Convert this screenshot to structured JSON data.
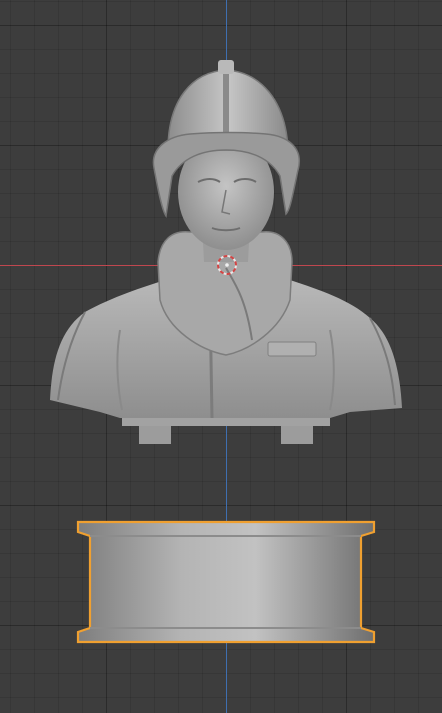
{
  "viewport": {
    "background": "#3d3d3d",
    "grid_color": "#2f2f2f",
    "x_axis_color": "#c0474f",
    "y_axis_color": "#3f6fb0",
    "selection_outline_color": "#f0a030",
    "model_color": "#a9a9a9"
  },
  "objects": {
    "bust": {
      "icon": "bust-model",
      "selected": false
    },
    "base": {
      "icon": "cylinder-base",
      "selected": true
    },
    "cursor": {
      "icon": "3d-cursor-icon"
    }
  }
}
